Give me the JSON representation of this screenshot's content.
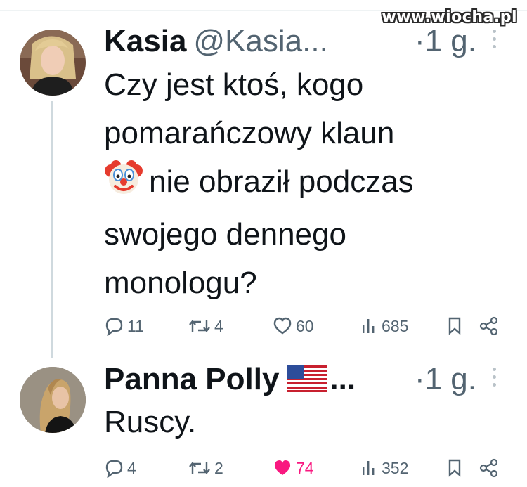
{
  "watermark": "www.wiocha.pl",
  "tweets": [
    {
      "name": "Kasia",
      "handle": "@Kasia...",
      "time": "·1 g.",
      "text_lines": [
        "Czy jest ktoś, kogo",
        "pomarańczowy klaun",
        "nie obraził podczas",
        "swojego dennego",
        "monologu?"
      ],
      "emoji_icon": "clown-face-icon",
      "stats": {
        "replies": "11",
        "retweets": "4",
        "likes": "60",
        "views": "685"
      },
      "liked": false
    },
    {
      "name": "Panna Polly",
      "name_suffix": "...",
      "flag_icon": "us-flag-icon",
      "time": "·1 g.",
      "text_lines": [
        "Ruscy."
      ],
      "stats": {
        "replies": "4",
        "retweets": "2",
        "likes": "74",
        "views": "352"
      },
      "liked": true
    }
  ],
  "colors": {
    "text": "#0f1419",
    "secondary": "#536471",
    "like_active": "#f91880",
    "thread_line": "#cfd9de"
  }
}
